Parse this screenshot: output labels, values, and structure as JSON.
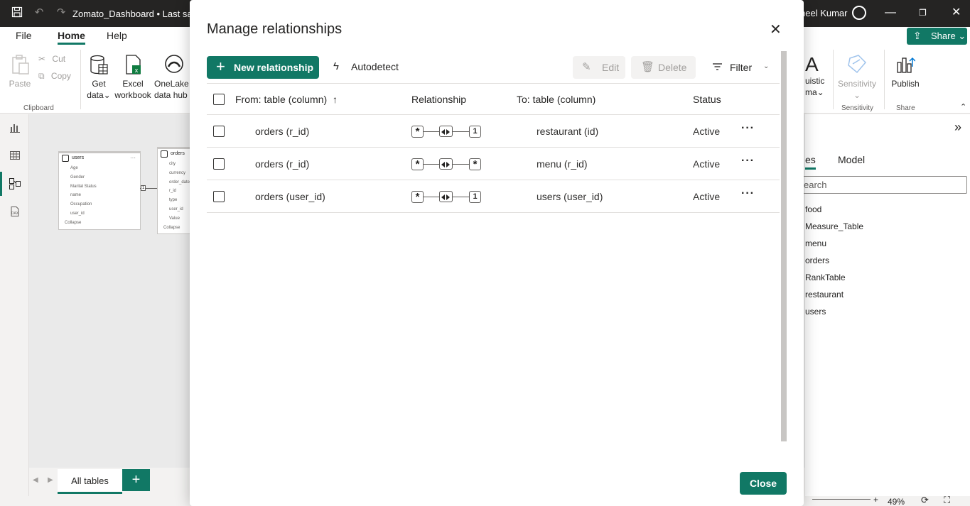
{
  "window": {
    "doc_title": "Zomato_Dashboard • Last save",
    "user_name": "neel Kumar"
  },
  "ribbon": {
    "tabs": [
      "File",
      "Home",
      "Help"
    ],
    "share_label": "Share",
    "paste": "Paste",
    "cut": "Cut",
    "copy": "Copy",
    "clipboard_group": "Clipboard",
    "get_data": "Get",
    "get_data_2": "data",
    "excel": "Excel",
    "excel_2": "workbook",
    "onelake": "OneLake",
    "onelake_2": "data hub",
    "linguistic": "uistic",
    "linguistic_2": "ma",
    "sensitivity": "Sensitivity",
    "sensitivity_group": "Sensitivity",
    "publish": "Publish",
    "share_group": "Share"
  },
  "canvas": {
    "users_table": {
      "title": "users",
      "fields": [
        "Age",
        "Gender",
        "Marital Status",
        "name",
        "Occupation",
        "user_id"
      ],
      "collapse": "Collapse"
    },
    "orders_table": {
      "title": "orders",
      "fields": [
        "city",
        "currency",
        "order_date",
        "r_id",
        "type",
        "user_id",
        "Value"
      ],
      "collapse": "Collapse"
    },
    "connector_label": "1"
  },
  "tabbar": {
    "tab_label": "All tables",
    "add_label": "+"
  },
  "right_panel": {
    "tab_data": "es",
    "tab_model": "Model",
    "search_placeholder": "earch",
    "items": [
      "food",
      "Measure_Table",
      "menu",
      "orders",
      "RankTable",
      "restaurant",
      "users"
    ]
  },
  "status": {
    "zoom": "49%"
  },
  "dialog": {
    "title": "Manage relationships",
    "new_relationship": "New relationship",
    "autodetect": "Autodetect",
    "edit": "Edit",
    "delete": "Delete",
    "filter": "Filter",
    "close": "Close",
    "columns": {
      "from": "From: table (column)",
      "relationship": "Relationship",
      "to": "To: table (column)",
      "status": "Status"
    },
    "rows": [
      {
        "from": "orders (r_id)",
        "from_card": "*",
        "to_card": "1",
        "to": "restaurant (id)",
        "status": "Active"
      },
      {
        "from": "orders (r_id)",
        "from_card": "*",
        "to_card": "*",
        "to": "menu (r_id)",
        "status": "Active"
      },
      {
        "from": "orders (user_id)",
        "from_card": "*",
        "to_card": "1",
        "to": "users (user_id)",
        "status": "Active"
      }
    ]
  },
  "colors": {
    "accent": "#117865",
    "titlebar": "#252423"
  },
  "icons": [
    "save-icon",
    "undo-icon",
    "redo-icon",
    "avatar-icon",
    "minimize-icon",
    "maximize-icon",
    "close-icon",
    "share-icon",
    "paste-icon",
    "cut-icon",
    "copy-icon",
    "database-icon",
    "excel-icon",
    "onelake-icon",
    "report-view-icon",
    "table-view-icon",
    "model-view-icon",
    "dax-query-icon",
    "plus-icon",
    "autodetect-icon",
    "edit-icon",
    "delete-icon",
    "filter-icon",
    "sort-ascending-icon",
    "more-options-icon"
  ]
}
